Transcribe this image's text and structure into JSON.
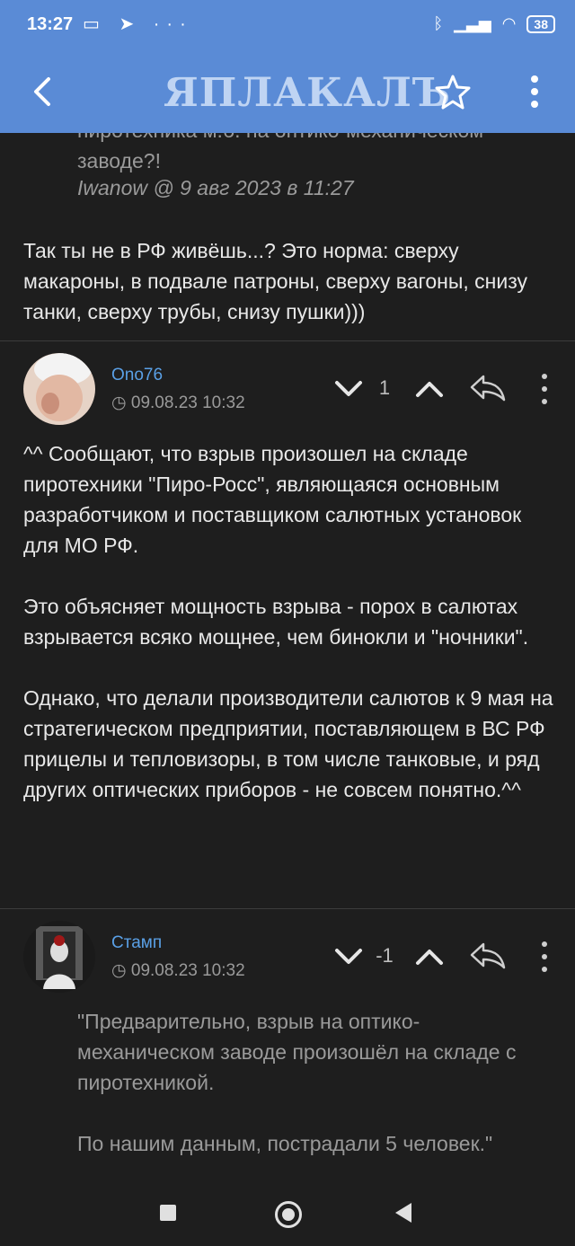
{
  "status": {
    "time": "13:27",
    "battery": "38"
  },
  "header": {
    "logo": "ЯПЛАКАЛЪ"
  },
  "top_quote": {
    "lines": [
      "пиротехника м.б. на оптико-механическом",
      "заводе?!"
    ],
    "author_line": "Iwanow @ 9 авг 2023 в 11:27"
  },
  "post1": {
    "text": "Так ты не в РФ живёшь...? Это норма: сверху макароны, в подвале патроны, сверху вагоны, снизу танки, сверху трубы, снизу пушки)))"
  },
  "post2": {
    "author": "Ono76",
    "date": "09.08.23 10:32",
    "score": "1",
    "paragraphs": [
      "^^ Сообщают, что взрыв произошел на складе пиротехники \"Пиро-Росс\", являющаяся основным разработчиком и поставщиком салютных установок для МО РФ.",
      "Это объясняет мощность взрыва - порох в салютах взрывается всяко мощнее, чем бинокли и \"ночники\".",
      "Однако, что делали производители салютов к 9 мая на стратегическом предприятии, поставляющем в ВС РФ прицелы и тепловизоры, в том числе танковые, и ряд других оптических приборов - не совсем понятно.^^"
    ]
  },
  "post3": {
    "author": "Стамп",
    "date": "09.08.23 10:32",
    "score": "-1",
    "quote_paragraphs": [
      "\"Предварительно, взрыв на оптико-механическом заводе произошёл на складе с пиротехникой.",
      "По нашим данным, пострадали 5 человек.\""
    ]
  },
  "colors": {
    "header_bg": "#5a8bd6",
    "page_bg": "#1e1e1e",
    "author": "#5aa0e6"
  }
}
